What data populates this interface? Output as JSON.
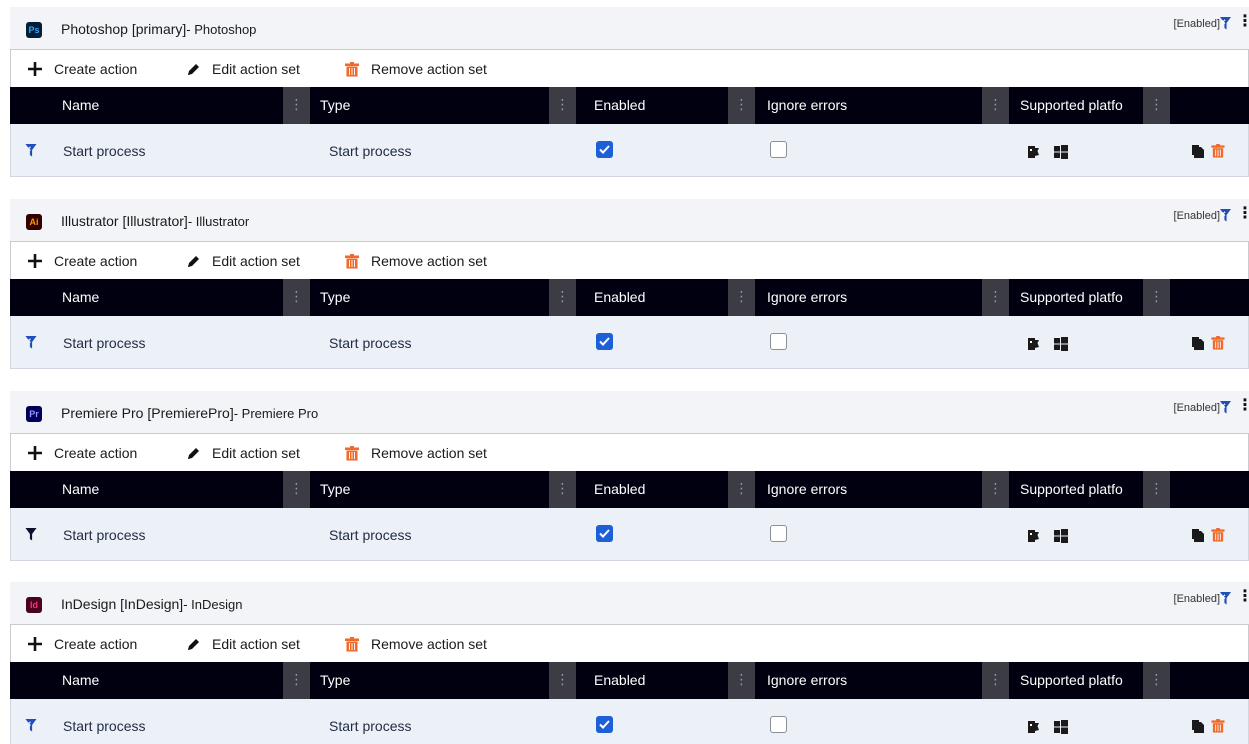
{
  "colors": {
    "header_bg": "#f3f4f7",
    "table_header_bg": "#000010",
    "row_bg": "#ecf1f8",
    "checkbox_blue": "#1d5fd6",
    "delete_orange": "#ef6a2a",
    "filter_blue": "#1f4fb8"
  },
  "sets": [
    {
      "badge": "Ps",
      "badge_bg": "#001e36",
      "badge_fg": "#31a8ff",
      "title": "Photoshop [primary]",
      "subtitle": "- Photoshop",
      "status": "[Enabled]",
      "toolbar": {
        "create": "Create action",
        "edit": "Edit action set",
        "remove": "Remove action set"
      },
      "columns": [
        "Name",
        "Type",
        "Enabled",
        "Ignore errors",
        "Supported platfo"
      ],
      "rows": [
        {
          "name": "Start process",
          "type": "Start process",
          "enabled": true,
          "ignore_errors": false,
          "filter_icon": "filter-clear-icon"
        }
      ]
    },
    {
      "badge": "Ai",
      "badge_bg": "#330000",
      "badge_fg": "#ff9a00",
      "title": "Illustrator [Illustrator]",
      "subtitle": "- Illustrator",
      "status": "[Enabled]",
      "toolbar": {
        "create": "Create action",
        "edit": "Edit action set",
        "remove": "Remove action set"
      },
      "columns": [
        "Name",
        "Type",
        "Enabled",
        "Ignore errors",
        "Supported platfo"
      ],
      "rows": [
        {
          "name": "Start process",
          "type": "Start process",
          "enabled": true,
          "ignore_errors": false,
          "filter_icon": "filter-clear-icon"
        }
      ]
    },
    {
      "badge": "Pr",
      "badge_bg": "#00005b",
      "badge_fg": "#9999ff",
      "title": "Premiere Pro [PremierePro]",
      "subtitle": "- Premiere Pro",
      "status": "[Enabled]",
      "toolbar": {
        "create": "Create action",
        "edit": "Edit action set",
        "remove": "Remove action set"
      },
      "columns": [
        "Name",
        "Type",
        "Enabled",
        "Ignore errors",
        "Supported platfo"
      ],
      "rows": [
        {
          "name": "Start process",
          "type": "Start process",
          "enabled": true,
          "ignore_errors": false,
          "filter_icon": "filter-icon"
        }
      ]
    },
    {
      "badge": "Id",
      "badge_bg": "#49021f",
      "badge_fg": "#ff3366",
      "title": "InDesign [InDesign]",
      "subtitle": "- InDesign",
      "status": "[Enabled]",
      "toolbar": {
        "create": "Create action",
        "edit": "Edit action set",
        "remove": "Remove action set"
      },
      "columns": [
        "Name",
        "Type",
        "Enabled",
        "Ignore errors",
        "Supported platfo"
      ],
      "rows": [
        {
          "name": "Start process",
          "type": "Start process",
          "enabled": true,
          "ignore_errors": false,
          "filter_icon": "filter-clear-icon"
        }
      ]
    }
  ]
}
